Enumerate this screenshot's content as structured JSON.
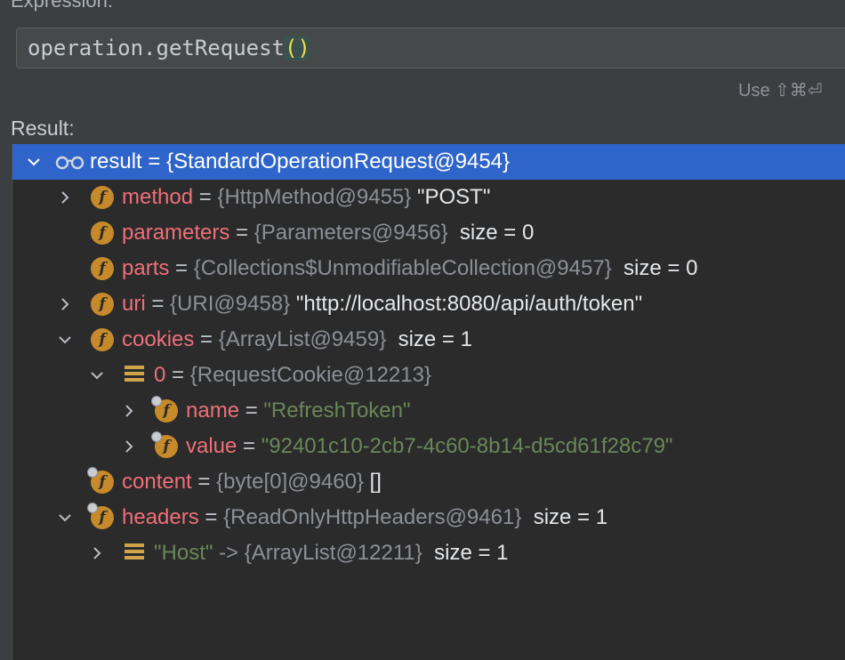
{
  "expression": {
    "label": "Expression:",
    "text_before": "operation.getRequest",
    "paren": "()",
    "use_hint": "Use ⇧⌘⏎"
  },
  "result_label": "Result:",
  "tree": {
    "root": {
      "name": "result",
      "eq": " = ",
      "value": "{StandardOperationRequest@9454}"
    },
    "rows": [
      {
        "name": "method",
        "type": "{HttpMethod@9455}",
        "value": "\"POST\""
      },
      {
        "name": "parameters",
        "type": "{Parameters@9456}",
        "value": "size = 0"
      },
      {
        "name": "parts",
        "type": "{Collections$UnmodifiableCollection@9457}",
        "value": "size = 0"
      },
      {
        "name": "uri",
        "type": "{URI@9458}",
        "value": "\"http://localhost:8080/api/auth/token\""
      },
      {
        "name": "cookies",
        "type": "{ArrayList@9459}",
        "value": "size = 1"
      },
      {
        "name": "0",
        "type": "{RequestCookie@12213}",
        "value": ""
      },
      {
        "name": "name",
        "type": "",
        "value": "\"RefreshToken\""
      },
      {
        "name": "value",
        "type": "",
        "value": "\"92401c10-2cb7-4c60-8b14-d5cd61f28c79\""
      },
      {
        "name": "content",
        "type": "{byte[0]@9460}",
        "value": "[]"
      },
      {
        "name": "headers",
        "type": "{ReadOnlyHttpHeaders@9461}",
        "value": "size = 1"
      },
      {
        "name": "\"Host\"",
        "type": "-> {ArrayList@12211}",
        "value": "size = 1"
      }
    ],
    "eq": " = ",
    "field_icon_letter": "f",
    "icons": {
      "field": "field-icon",
      "array": "array-icon",
      "watch": "watch-glasses-icon"
    }
  },
  "colors": {
    "background": "#3c3f41",
    "tree_background": "#2b2b2b",
    "selection": "#2f65ca",
    "field_name": "#ef6f78",
    "type_gray": "#8b9096",
    "string_green": "#6a8759",
    "field_icon": "#c68a2b"
  }
}
